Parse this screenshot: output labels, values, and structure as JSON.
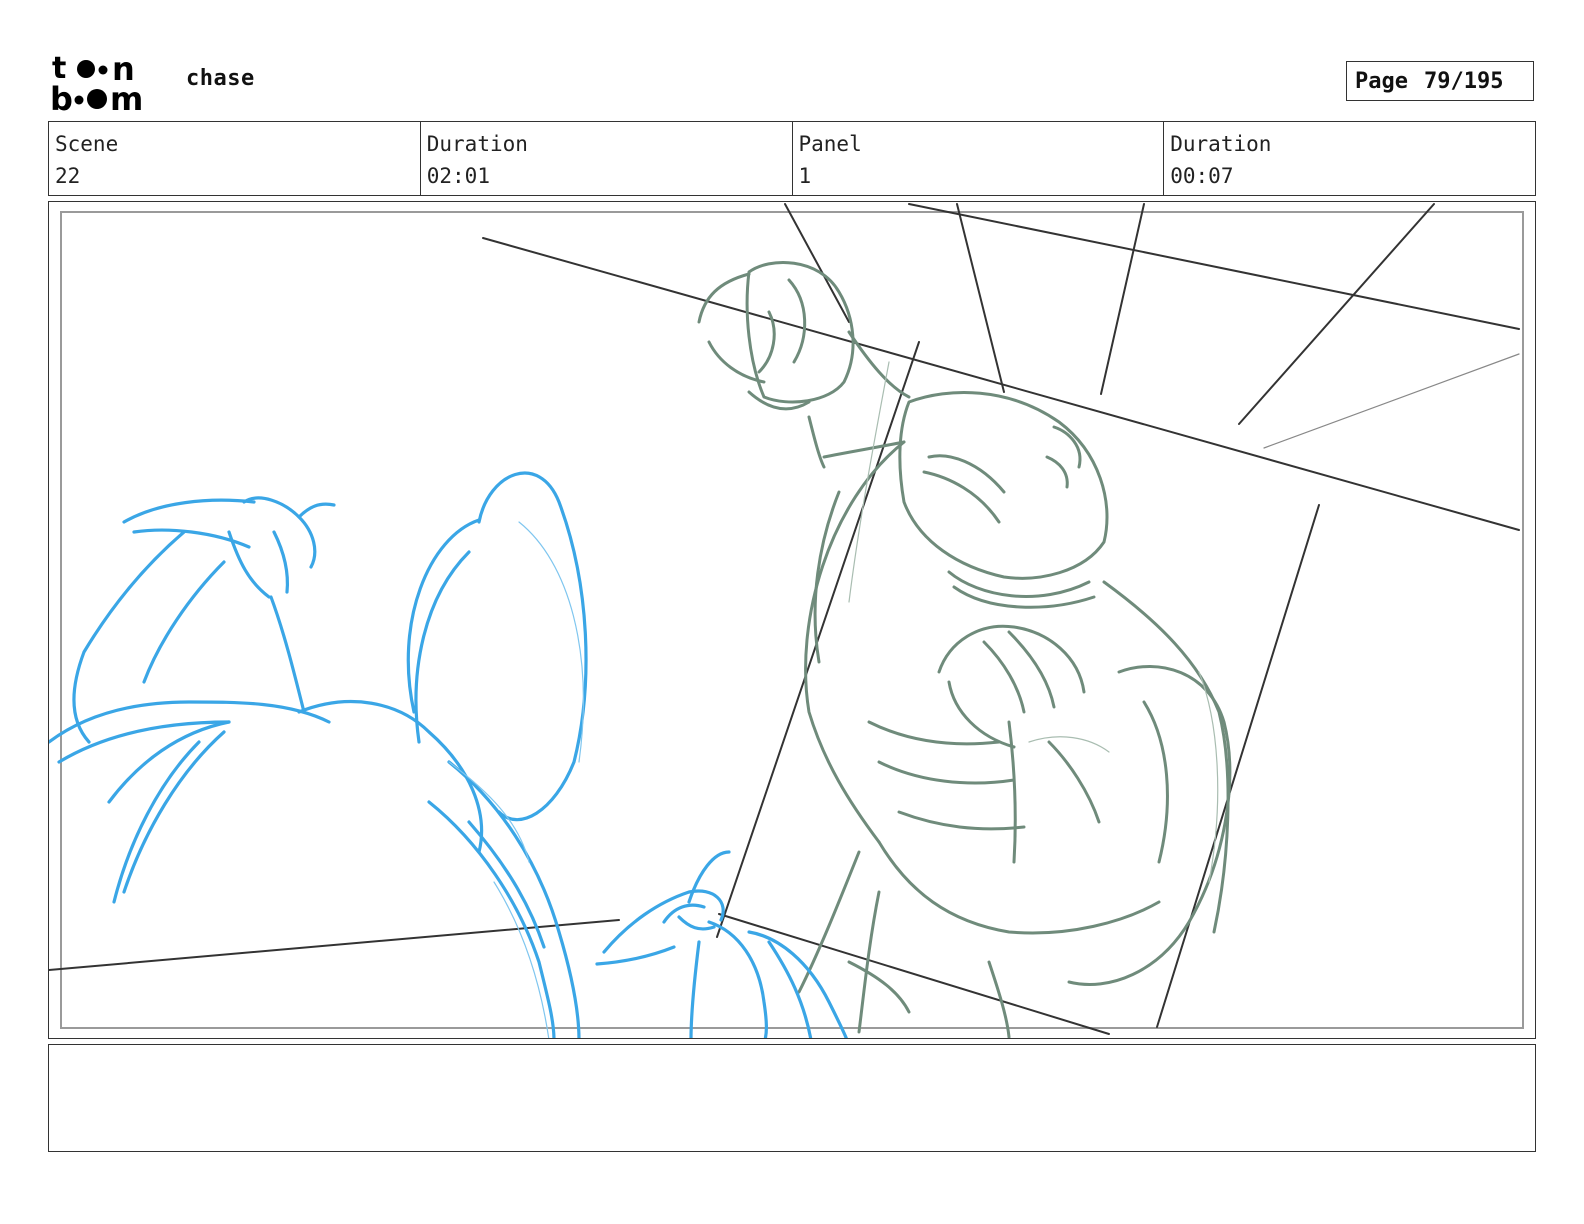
{
  "header": {
    "project_title": "chase",
    "page_label": "Page",
    "page_value": "79/195"
  },
  "info": {
    "scene_label": "Scene",
    "scene_value": "22",
    "scene_duration_label": "Duration",
    "scene_duration_value": "02:01",
    "panel_label": "Panel",
    "panel_value": "1",
    "panel_duration_label": "Duration",
    "panel_duration_value": "00:07"
  },
  "colors": {
    "foreground_sketch": "#3aa6e6",
    "background_character_sketch": "#6f8b7b",
    "layout_lines": "#333333"
  },
  "notes": {
    "text": ""
  }
}
